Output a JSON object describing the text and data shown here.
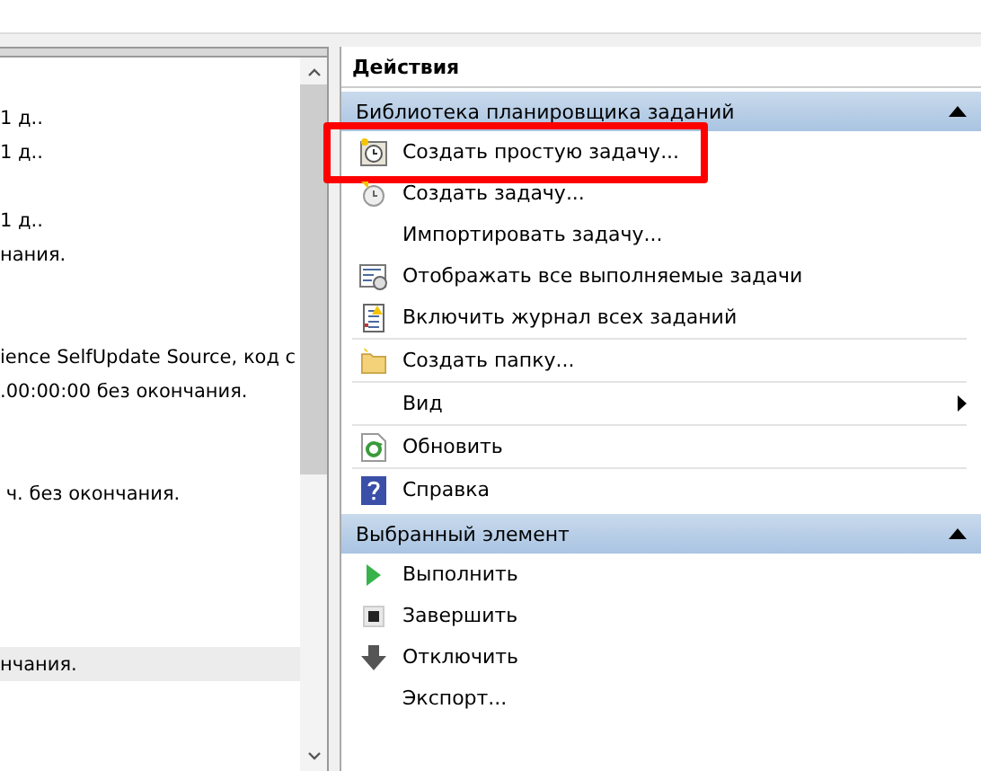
{
  "left_pane": {
    "rows": [
      {
        "text": "1 д..",
        "selected": false
      },
      {
        "text": "1 д..",
        "selected": false
      },
      {
        "text": "",
        "selected": false
      },
      {
        "text": "1 д..",
        "selected": false
      },
      {
        "text": "нания.",
        "selected": false
      },
      {
        "text": "",
        "selected": false
      },
      {
        "text": "",
        "selected": false
      },
      {
        "text": "ience SelfUpdate Source, код с",
        "selected": false
      },
      {
        "text": ".00:00:00 без окончания.",
        "selected": false
      },
      {
        "text": "",
        "selected": false
      },
      {
        "text": "",
        "selected": false
      },
      {
        "text": " ч. без окончания.",
        "selected": false
      },
      {
        "text": "",
        "selected": false
      },
      {
        "text": "",
        "selected": false
      },
      {
        "text": "",
        "selected": false
      },
      {
        "text": "",
        "selected": false
      },
      {
        "text": "нчания.",
        "selected": true
      }
    ]
  },
  "actions": {
    "title": "Действия",
    "sections": [
      {
        "title": "Библиотека планировщика заданий",
        "expanded": true,
        "items": [
          {
            "label": "Создать простую задачу...",
            "kind": "clock",
            "highlighted": true,
            "divider_before": false
          },
          {
            "label": "Создать задачу...",
            "kind": "clock-new",
            "highlighted": false,
            "divider_before": false
          },
          {
            "label": "Импортировать задачу...",
            "kind": "none",
            "highlighted": false,
            "divider_before": false
          },
          {
            "label": "Отображать все выполняемые задачи",
            "kind": "list",
            "highlighted": false,
            "divider_before": false
          },
          {
            "label": "Включить журнал всех заданий",
            "kind": "log",
            "highlighted": false,
            "divider_before": false
          },
          {
            "label": "Создать папку...",
            "kind": "folder",
            "highlighted": false,
            "divider_before": true
          },
          {
            "label": "Вид",
            "kind": "submenu",
            "highlighted": false,
            "divider_before": true
          },
          {
            "label": "Обновить",
            "kind": "refresh",
            "highlighted": false,
            "divider_before": true
          },
          {
            "label": "Справка",
            "kind": "help",
            "highlighted": false,
            "divider_before": true
          }
        ]
      },
      {
        "title": "Выбранный элемент",
        "expanded": true,
        "items": [
          {
            "label": "Выполнить",
            "kind": "run",
            "highlighted": false,
            "divider_before": false
          },
          {
            "label": "Завершить",
            "kind": "stop",
            "highlighted": false,
            "divider_before": false
          },
          {
            "label": "Отключить",
            "kind": "disable",
            "highlighted": false,
            "divider_before": false
          },
          {
            "label": "Экспорт...",
            "kind": "none",
            "highlighted": false,
            "divider_before": false
          }
        ]
      }
    ]
  }
}
